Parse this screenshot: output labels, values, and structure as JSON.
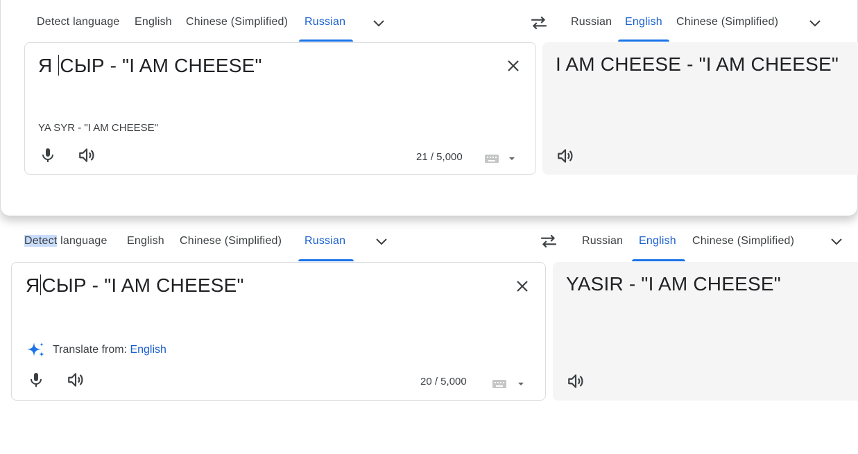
{
  "top": {
    "source_tabs": [
      "Detect language",
      "English",
      "Chinese (Simplified)",
      "Russian"
    ],
    "target_tabs": [
      "Russian",
      "English",
      "Chinese (Simplified)"
    ],
    "source_text_before_caret": "Я ",
    "source_text_after_caret": "СЫР - \"I AM CHEESE\"",
    "transliteration": "YA SYR - \"I AM CHEESE\"",
    "char_count": "21 / 5,000",
    "translation": "I AM CHEESE - \"I AM CHEESE\""
  },
  "bottom": {
    "source_tabs_detect_highlighted": "Detect",
    "source_tabs_detect_rest": " language",
    "source_tabs": [
      "English",
      "Chinese (Simplified)",
      "Russian"
    ],
    "target_tabs": [
      "Russian",
      "English",
      "Chinese (Simplified)"
    ],
    "source_text_before_caret": "Я",
    "source_text_after_caret": "СЫР - \"I AM CHEESE\"",
    "translate_from_label": "Translate from:",
    "translate_from_lang": "English",
    "char_count": "20 / 5,000",
    "translation": "YASIR - \"I AM CHEESE\""
  },
  "colors": {
    "accent": "#1a73e8",
    "active_tab_text": "#1a5fcf",
    "target_bg": "#f5f5f5"
  },
  "icons": [
    "swap-icon",
    "chevron-down-icon",
    "close-icon",
    "mic-icon",
    "speaker-icon",
    "keyboard-icon",
    "sparkle-icon"
  ]
}
